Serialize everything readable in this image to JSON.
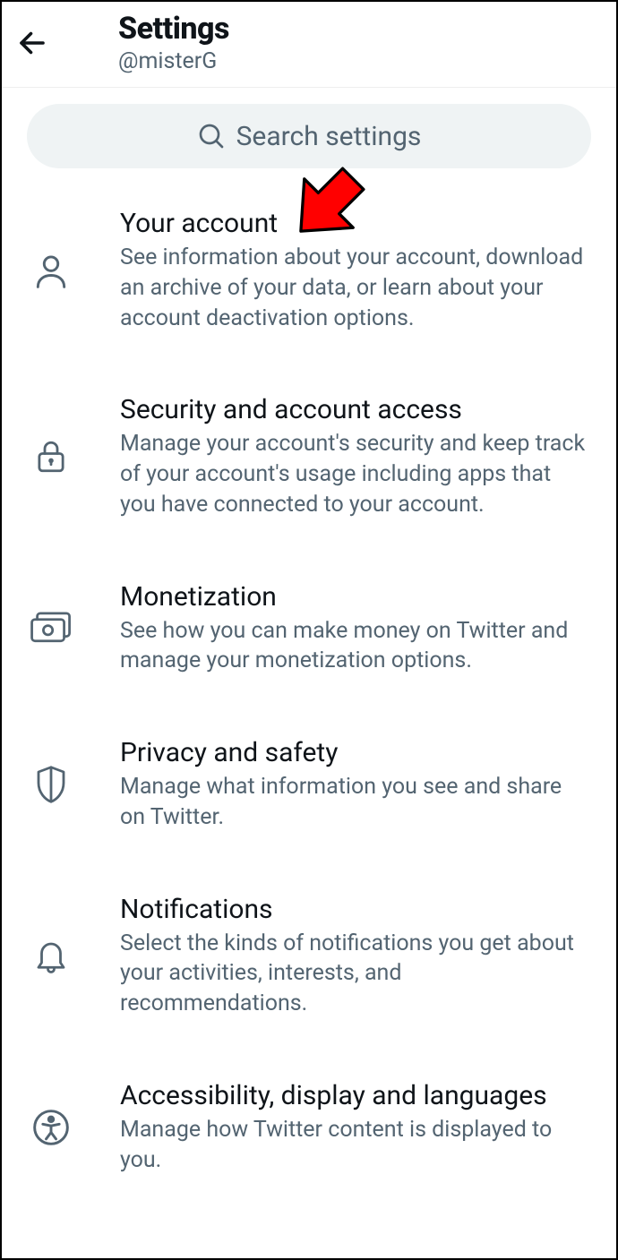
{
  "header": {
    "title": "Settings",
    "username": "@misterG"
  },
  "search": {
    "placeholder": "Search settings"
  },
  "items": [
    {
      "title": "Your account",
      "desc": "See information about your account, download an archive of your data, or learn about your account deactivation options."
    },
    {
      "title": "Security and account access",
      "desc": "Manage your account's security and keep track of your account's usage including apps that you have connected to your account."
    },
    {
      "title": "Monetization",
      "desc": "See how you can make money on Twitter and manage your monetization options."
    },
    {
      "title": "Privacy and safety",
      "desc": "Manage what information you see and share on Twitter."
    },
    {
      "title": "Notifications",
      "desc": "Select the kinds of notifications you get about your activities, interests, and recommendations."
    },
    {
      "title": "Accessibility, display and languages",
      "desc": "Manage how Twitter content is displayed to you."
    }
  ]
}
